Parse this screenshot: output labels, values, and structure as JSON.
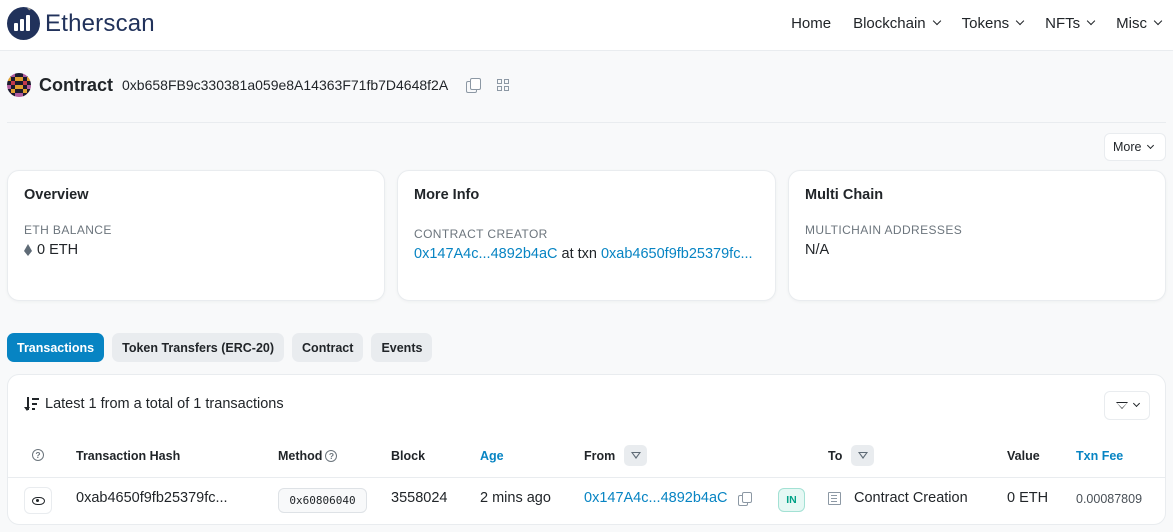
{
  "brand": {
    "name": "Etherscan"
  },
  "nav": {
    "items": [
      {
        "label": "Home",
        "dropdown": false
      },
      {
        "label": "Blockchain",
        "dropdown": true
      },
      {
        "label": "Tokens",
        "dropdown": true
      },
      {
        "label": "NFTs",
        "dropdown": true
      },
      {
        "label": "Misc",
        "dropdown": true
      }
    ]
  },
  "contract": {
    "title": "Contract",
    "address": "0xb658FB9c330381a059e8A14363F71fb7D4648f2A"
  },
  "more_button": {
    "label": "More"
  },
  "cards": {
    "overview": {
      "title": "Overview",
      "label": "ETH BALANCE",
      "value": "0 ETH"
    },
    "more_info": {
      "title": "More Info",
      "label": "CONTRACT CREATOR",
      "creator": "0x147A4c...4892b4aC",
      "at_txn": "at txn",
      "txn": "0xab4650f9fb25379fc..."
    },
    "multi_chain": {
      "title": "Multi Chain",
      "label": "MULTICHAIN ADDRESSES",
      "value": "N/A"
    }
  },
  "tabs": [
    {
      "label": "Transactions",
      "active": true
    },
    {
      "label": "Token Transfers (ERC-20)",
      "active": false
    },
    {
      "label": "Contract",
      "active": false
    },
    {
      "label": "Events",
      "active": false
    }
  ],
  "transactions": {
    "summary": "Latest 1 from a total of 1 transactions",
    "headers": {
      "hash": "Transaction Hash",
      "method": "Method",
      "block": "Block",
      "age": "Age",
      "from": "From",
      "to": "To",
      "value": "Value",
      "fee": "Txn Fee"
    },
    "rows": [
      {
        "hash": "0xab4650f9fb25379fc...",
        "method": "0x60806040",
        "block": "3558024",
        "age": "2 mins ago",
        "from": "0x147A4c...4892b4aC",
        "direction": "IN",
        "to": "Contract Creation",
        "value": "0 ETH",
        "fee": "0.00087809"
      }
    ]
  },
  "colors": {
    "accent": "#0784c3",
    "brand": "#21325b",
    "in_badge": "#00a186"
  }
}
